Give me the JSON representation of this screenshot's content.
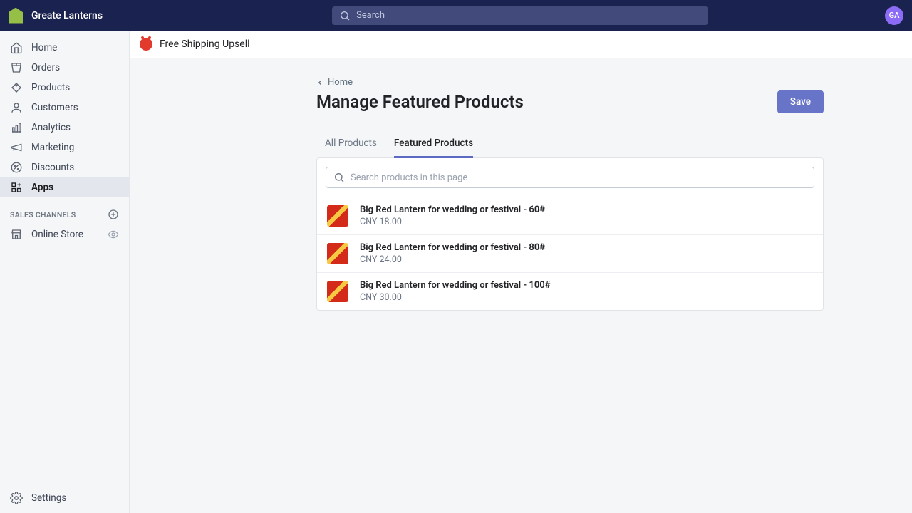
{
  "topbar": {
    "store_name": "Greate Lanterns",
    "search_placeholder": "Search",
    "avatar_initials": "GA"
  },
  "sidebar": {
    "items": [
      {
        "label": "Home"
      },
      {
        "label": "Orders"
      },
      {
        "label": "Products"
      },
      {
        "label": "Customers"
      },
      {
        "label": "Analytics"
      },
      {
        "label": "Marketing"
      },
      {
        "label": "Discounts"
      },
      {
        "label": "Apps"
      }
    ],
    "section_label": "SALES CHANNELS",
    "channels": [
      {
        "label": "Online Store"
      }
    ],
    "settings_label": "Settings"
  },
  "app": {
    "name": "Free Shipping Upsell"
  },
  "page": {
    "breadcrumb": "Home",
    "title": "Manage Featured Products",
    "save_label": "Save",
    "tabs": [
      {
        "label": "All Products"
      },
      {
        "label": "Featured Products"
      }
    ],
    "active_tab": 1,
    "product_search_placeholder": "Search products in this page",
    "products": [
      {
        "name": "Big Red Lantern for wedding or festival - 60#",
        "price": "CNY 18.00"
      },
      {
        "name": "Big Red Lantern for wedding or festival - 80#",
        "price": "CNY 24.00"
      },
      {
        "name": "Big Red Lantern for wedding or festival - 100#",
        "price": "CNY 30.00"
      }
    ]
  }
}
